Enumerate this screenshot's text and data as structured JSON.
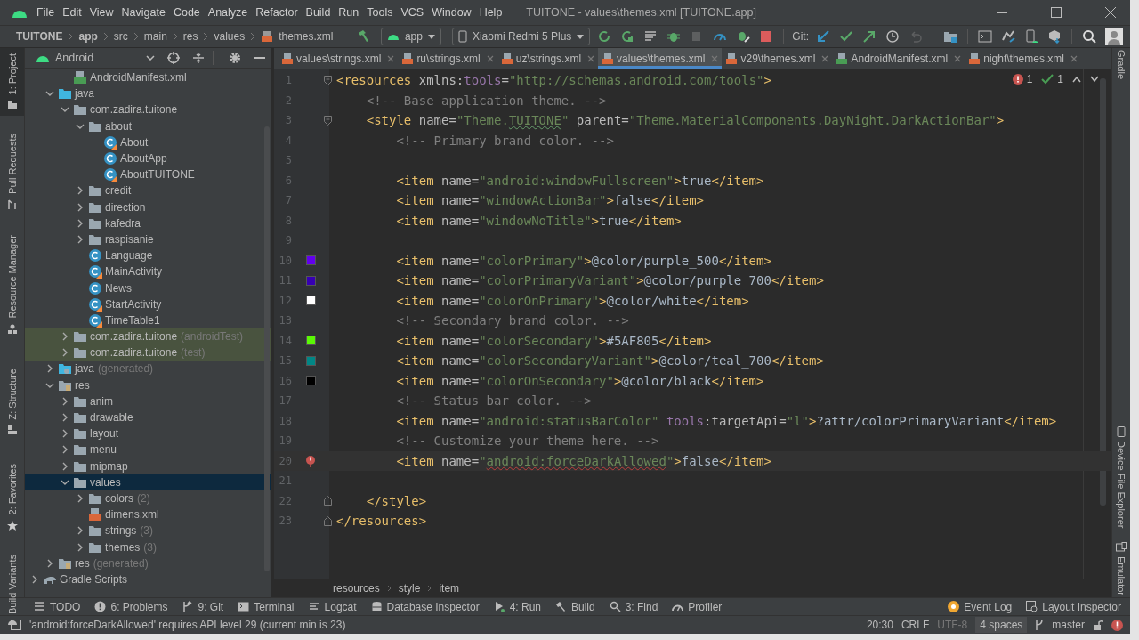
{
  "menu": [
    "File",
    "Edit",
    "View",
    "Navigate",
    "Code",
    "Analyze",
    "Refactor",
    "Build",
    "Run",
    "Tools",
    "VCS",
    "Window",
    "Help"
  ],
  "window_title": "TUITONE - values\\themes.xml [TUITONE.app]",
  "nav": [
    {
      "text": "TUITONE",
      "kind": "project"
    },
    {
      "text": "app",
      "kind": "module"
    },
    {
      "text": "src",
      "kind": "dir"
    },
    {
      "text": "main",
      "kind": "dir"
    },
    {
      "text": "res",
      "kind": "dir"
    },
    {
      "text": "values",
      "kind": "dir"
    },
    {
      "text": "themes.xml",
      "kind": "file"
    }
  ],
  "run_config": "app",
  "device": "Xiaomi Redmi 5 Plus",
  "git_label": "Git:",
  "left_tools": [
    {
      "label": "1: Project",
      "selected": true,
      "kind": "folder"
    },
    {
      "label": "Pull Requests",
      "selected": false,
      "kind": "pull"
    },
    {
      "label": "Resource Manager",
      "selected": false,
      "kind": "resource"
    },
    {
      "label": "Z: Structure",
      "selected": false,
      "kind": "structure"
    },
    {
      "label": "2: Favorites",
      "selected": false,
      "kind": "star"
    },
    {
      "label": "Build Variants",
      "selected": false,
      "kind": "variants"
    }
  ],
  "right_tools": [
    {
      "label": "Gradle",
      "kind": "none"
    },
    {
      "label": "Device File Explorer",
      "kind": "phone"
    },
    {
      "label": "Emulator",
      "kind": "emulator"
    }
  ],
  "project_view": "Android",
  "tree": [
    {
      "children": [
        {
          "children": [
            {
              "label": "AndroidManifest.xml",
              "kind": "manifest",
              "selected": false
            }
          ]
        },
        {
          "label": "java",
          "kind": "source",
          "expanded": true,
          "selected": false,
          "children": [
            {
              "label": "com.zadira.tuitone",
              "kind": "package",
              "expanded": true,
              "selected": false,
              "children": [
                {
                  "label": "about",
                  "kind": "package",
                  "expanded": true,
                  "selected": false,
                  "children": [
                    {
                      "label": "About",
                      "kind": "kclass",
                      "selected": false
                    },
                    {
                      "label": "AboutApp",
                      "kind": "class",
                      "selected": false
                    },
                    {
                      "label": "AboutTUITONE",
                      "kind": "kclass",
                      "selected": false
                    }
                  ]
                },
                {
                  "label": "credit",
                  "kind": "package",
                  "expanded": false,
                  "selected": false
                },
                {
                  "label": "direction",
                  "kind": "package",
                  "expanded": false,
                  "selected": false
                },
                {
                  "label": "kafedra",
                  "kind": "package",
                  "expanded": false,
                  "selected": false
                },
                {
                  "label": "raspisanie",
                  "kind": "package",
                  "expanded": false,
                  "selected": false
                },
                {
                  "label": "Language",
                  "kind": "class",
                  "selected": false
                },
                {
                  "label": "MainActivity",
                  "kind": "kclass",
                  "selected": false
                },
                {
                  "label": "News",
                  "kind": "class",
                  "selected": false
                },
                {
                  "label": "StartActivity",
                  "kind": "kclass",
                  "selected": false
                },
                {
                  "label": "TimeTable1",
                  "kind": "kclass",
                  "selected": false
                }
              ]
            },
            {
              "label": "com.zadira.tuitone",
              "suffix": "(androidTest)",
              "kind": "package",
              "expanded": false,
              "selected": false,
              "test_source": true
            },
            {
              "label": "com.zadira.tuitone",
              "suffix": "(test)",
              "kind": "package",
              "expanded": false,
              "selected": false,
              "test_source": true
            }
          ]
        },
        {
          "label": "java",
          "suffix": "(generated)",
          "kind": "gensource",
          "expanded": false,
          "selected": false
        },
        {
          "label": "res",
          "kind": "res",
          "expanded": true,
          "selected": false,
          "children": [
            {
              "label": "anim",
              "kind": "package",
              "expanded": false,
              "selected": false
            },
            {
              "label": "drawable",
              "kind": "package",
              "expanded": false,
              "selected": false
            },
            {
              "label": "layout",
              "kind": "package",
              "expanded": false,
              "selected": false
            },
            {
              "label": "menu",
              "kind": "package",
              "expanded": false,
              "selected": false
            },
            {
              "label": "mipmap",
              "kind": "package",
              "expanded": false,
              "selected": false
            },
            {
              "label": "values",
              "kind": "package",
              "expanded": true,
              "selected": true,
              "children": [
                {
                  "label": "colors",
                  "suffix": "(2)",
                  "kind": "package",
                  "expanded": false,
                  "selected": false
                },
                {
                  "label": "dimens.xml",
                  "kind": "xml",
                  "selected": false
                },
                {
                  "label": "strings",
                  "suffix": "(3)",
                  "kind": "package",
                  "expanded": false,
                  "selected": false
                },
                {
                  "label": "themes",
                  "suffix": "(3)",
                  "kind": "package",
                  "expanded": false,
                  "selected": false
                }
              ]
            }
          ]
        },
        {
          "label": "res",
          "suffix": "(generated)",
          "kind": "res",
          "expanded": false,
          "selected": false
        }
      ]
    },
    {
      "label": "Gradle Scripts",
      "kind": "gradle",
      "expanded": false,
      "selected": false
    }
  ],
  "tabs": [
    {
      "label": "values\\strings.xml",
      "kind": "xml",
      "selected": false
    },
    {
      "label": "ru\\strings.xml",
      "kind": "xml",
      "selected": false
    },
    {
      "label": "uz\\strings.xml",
      "kind": "xml",
      "selected": false
    },
    {
      "label": "values\\themes.xml",
      "kind": "xml",
      "selected": true
    },
    {
      "label": "v29\\themes.xml",
      "kind": "xml",
      "selected": false
    },
    {
      "label": "AndroidManifest.xml",
      "kind": "manifest",
      "selected": false
    },
    {
      "label": "night\\themes.xml",
      "kind": "xml",
      "selected": false
    }
  ],
  "inspections": {
    "errors": "1",
    "warnings": "1"
  },
  "lines": [
    {
      "num": "1",
      "fold_open": true,
      "segs": [
        {
          "kind": "tag",
          "text": "<resources"
        },
        {
          "kind": "attr",
          "text": " xmlns:"
        },
        {
          "kind": "ns",
          "text": "tools"
        },
        {
          "kind": "attr",
          "text": "="
        },
        {
          "kind": "str",
          "text": "\"http://schemas.android.com/tools\""
        },
        {
          "kind": "tag",
          "text": ">"
        }
      ]
    },
    {
      "num": "2",
      "segs": [
        {
          "kind": "comment",
          "text": "    <!-- Base application theme. -->"
        }
      ]
    },
    {
      "num": "3",
      "fold_open": true,
      "segs": [
        {
          "kind": "tag",
          "text": "    <style"
        },
        {
          "kind": "attr",
          "text": " name="
        },
        {
          "kind": "str",
          "text": "\"Theme."
        },
        {
          "kind": "typo",
          "text": "TUITONE"
        },
        {
          "kind": "str",
          "text": "\""
        },
        {
          "kind": "attr",
          "text": " parent="
        },
        {
          "kind": "str",
          "text": "\"Theme.MaterialComponents.DayNight.DarkActionBar\""
        },
        {
          "kind": "tag",
          "text": ">"
        }
      ]
    },
    {
      "num": "4",
      "segs": [
        {
          "kind": "comment",
          "text": "        <!-- Primary brand color. -->"
        }
      ]
    },
    {
      "num": "5"
    },
    {
      "num": "6",
      "segs": [
        {
          "kind": "tag",
          "text": "        <item"
        },
        {
          "kind": "attr",
          "text": " name="
        },
        {
          "kind": "str",
          "text": "\"android:windowFullscreen\""
        },
        {
          "kind": "tag",
          "text": ">"
        },
        {
          "kind": "text",
          "text": "true"
        },
        {
          "kind": "tag",
          "text": "</item>"
        }
      ]
    },
    {
      "num": "7",
      "segs": [
        {
          "kind": "tag",
          "text": "        <item"
        },
        {
          "kind": "attr",
          "text": " name="
        },
        {
          "kind": "str",
          "text": "\"windowActionBar\""
        },
        {
          "kind": "tag",
          "text": ">"
        },
        {
          "kind": "text",
          "text": "false"
        },
        {
          "kind": "tag",
          "text": "</item>"
        }
      ]
    },
    {
      "num": "8",
      "segs": [
        {
          "kind": "tag",
          "text": "        <item"
        },
        {
          "kind": "attr",
          "text": " name="
        },
        {
          "kind": "str",
          "text": "\"windowNoTitle\""
        },
        {
          "kind": "tag",
          "text": ">"
        },
        {
          "kind": "text",
          "text": "true"
        },
        {
          "kind": "tag",
          "text": "</item>"
        }
      ]
    },
    {
      "num": "9"
    },
    {
      "num": "10",
      "color": "#6200ee",
      "segs": [
        {
          "kind": "tag",
          "text": "        <item"
        },
        {
          "kind": "attr",
          "text": " name="
        },
        {
          "kind": "str",
          "text": "\"colorPrimary\""
        },
        {
          "kind": "tag",
          "text": ">"
        },
        {
          "kind": "text",
          "text": "@color/purple_500"
        },
        {
          "kind": "tag",
          "text": "</item>"
        }
      ]
    },
    {
      "num": "11",
      "color": "#3700b3",
      "segs": [
        {
          "kind": "tag",
          "text": "        <item"
        },
        {
          "kind": "attr",
          "text": " name="
        },
        {
          "kind": "str",
          "text": "\"colorPrimaryVariant\""
        },
        {
          "kind": "tag",
          "text": ">"
        },
        {
          "kind": "text",
          "text": "@color/purple_700"
        },
        {
          "kind": "tag",
          "text": "</item>"
        }
      ]
    },
    {
      "num": "12",
      "color": "#ffffff",
      "segs": [
        {
          "kind": "tag",
          "text": "        <item"
        },
        {
          "kind": "attr",
          "text": " name="
        },
        {
          "kind": "str",
          "text": "\"colorOnPrimary\""
        },
        {
          "kind": "tag",
          "text": ">"
        },
        {
          "kind": "text",
          "text": "@color/white"
        },
        {
          "kind": "tag",
          "text": "</item>"
        }
      ]
    },
    {
      "num": "13",
      "segs": [
        {
          "kind": "comment",
          "text": "        <!-- Secondary brand color. -->"
        }
      ]
    },
    {
      "num": "14",
      "color": "#5af805",
      "segs": [
        {
          "kind": "tag",
          "text": "        <item"
        },
        {
          "kind": "attr",
          "text": " name="
        },
        {
          "kind": "str",
          "text": "\"colorSecondary\""
        },
        {
          "kind": "tag",
          "text": ">"
        },
        {
          "kind": "text",
          "text": "#5AF805"
        },
        {
          "kind": "tag",
          "text": "</item>"
        }
      ]
    },
    {
      "num": "15",
      "color": "#018786",
      "segs": [
        {
          "kind": "tag",
          "text": "        <item"
        },
        {
          "kind": "attr",
          "text": " name="
        },
        {
          "kind": "str",
          "text": "\"colorSecondaryVariant\""
        },
        {
          "kind": "tag",
          "text": ">"
        },
        {
          "kind": "text",
          "text": "@color/teal_700"
        },
        {
          "kind": "tag",
          "text": "</item>"
        }
      ]
    },
    {
      "num": "16",
      "color": "#000000",
      "segs": [
        {
          "kind": "tag",
          "text": "        <item"
        },
        {
          "kind": "attr",
          "text": " name="
        },
        {
          "kind": "str",
          "text": "\"colorOnSecondary\""
        },
        {
          "kind": "tag",
          "text": ">"
        },
        {
          "kind": "text",
          "text": "@color/black"
        },
        {
          "kind": "tag",
          "text": "</item>"
        }
      ]
    },
    {
      "num": "17",
      "segs": [
        {
          "kind": "comment",
          "text": "        <!-- Status bar color. -->"
        }
      ]
    },
    {
      "num": "18",
      "segs": [
        {
          "kind": "tag",
          "text": "        <item"
        },
        {
          "kind": "attr",
          "text": " name="
        },
        {
          "kind": "str",
          "text": "\"android:statusBarColor\" "
        },
        {
          "kind": "ns",
          "text": "tools"
        },
        {
          "kind": "attr",
          "text": ":targetApi="
        },
        {
          "kind": "str",
          "text": "\"l\""
        },
        {
          "kind": "tag",
          "text": ">"
        },
        {
          "kind": "text",
          "text": "?attr/colorPrimaryVariant"
        },
        {
          "kind": "tag",
          "text": "</item>"
        }
      ]
    },
    {
      "num": "19",
      "segs": [
        {
          "kind": "comment",
          "text": "        <!-- Customize your theme here. -->"
        }
      ]
    },
    {
      "num": "20",
      "error": true,
      "current": true,
      "segs": [
        {
          "kind": "tag",
          "text": "        <item"
        },
        {
          "kind": "attr",
          "text": " name="
        },
        {
          "kind": "str",
          "text": "\""
        },
        {
          "kind": "error",
          "text": "android:forceDarkAllowed"
        },
        {
          "kind": "str",
          "text": "\""
        },
        {
          "kind": "tag",
          "text": ">"
        },
        {
          "kind": "text",
          "text": "false"
        },
        {
          "kind": "tag",
          "text": "</item>"
        }
      ]
    },
    {
      "num": "21"
    },
    {
      "num": "22",
      "fold_close": true,
      "segs": [
        {
          "kind": "tag",
          "text": "    </style>"
        }
      ]
    },
    {
      "num": "23",
      "fold_close": true,
      "segs": [
        {
          "kind": "tag",
          "text": "</resources>"
        }
      ]
    }
  ],
  "editor_breadcrumb": [
    "resources",
    "style",
    "item"
  ],
  "tool_windows": [
    {
      "label": "TODO",
      "kind": "list"
    },
    {
      "label": "6: Problems",
      "kind": "problems"
    },
    {
      "label": "9: Git",
      "kind": "git"
    },
    {
      "label": "Terminal",
      "kind": "terminal"
    },
    {
      "label": "Logcat",
      "kind": "logcat"
    },
    {
      "label": "Database Inspector",
      "kind": "database"
    },
    {
      "label": "4: Run",
      "kind": "run"
    },
    {
      "label": "Build",
      "kind": "build"
    },
    {
      "label": "3: Find",
      "kind": "find"
    },
    {
      "label": "Profiler",
      "kind": "profiler"
    }
  ],
  "tool_windows_right": [
    {
      "label": "Event Log",
      "kind": "event"
    },
    {
      "label": "Layout Inspector",
      "kind": "inspector"
    }
  ],
  "status": {
    "message": "'android:forceDarkAllowed' requires API level 29 (current min is 23)",
    "position": "20:30",
    "line_separator": "CRLF",
    "encoding": "UTF-8",
    "indent": "4 spaces",
    "branch": "master"
  }
}
